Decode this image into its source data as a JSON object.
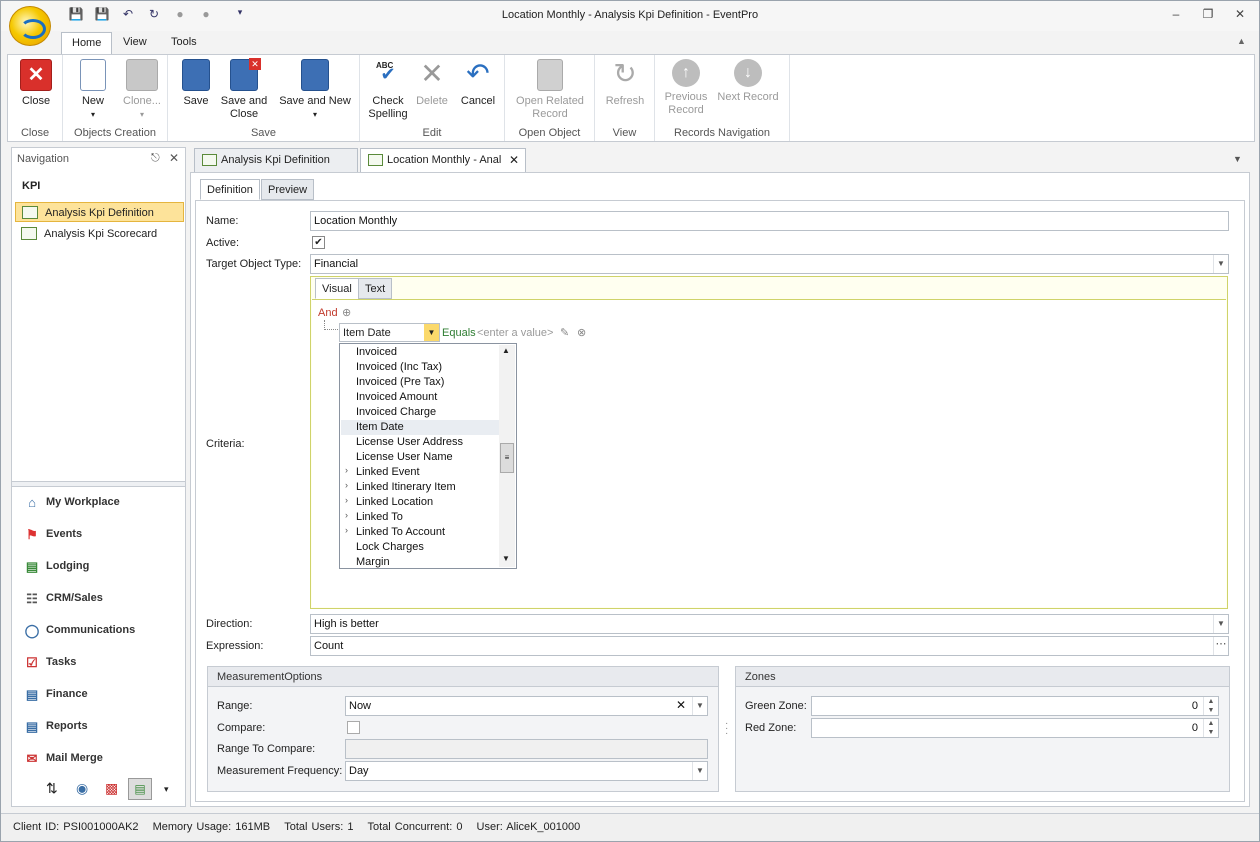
{
  "window": {
    "title": "Location Monthly - Analysis Kpi Definition - EventPro"
  },
  "ribbon_tabs": [
    "Home",
    "View",
    "Tools"
  ],
  "ribbon": {
    "close": {
      "label": "Close",
      "group": "Close"
    },
    "objects": {
      "new": "New",
      "clone": "Clone...",
      "group": "Objects Creation"
    },
    "save": {
      "save": "Save",
      "save_close_1": "Save and",
      "save_close_2": "Close",
      "save_new": "Save and New",
      "group": "Save"
    },
    "edit": {
      "check_1": "Check",
      "check_2": "Spelling",
      "delete": "Delete",
      "cancel": "Cancel",
      "group": "Edit",
      "abc": "ABC"
    },
    "open": {
      "l1": "Open Related",
      "l2": "Record",
      "group": "Open Object"
    },
    "view": {
      "refresh": "Refresh",
      "group": "View"
    },
    "nav": {
      "prev_1": "Previous",
      "prev_2": "Record",
      "next": "Next Record",
      "group": "Records Navigation"
    }
  },
  "navigation": {
    "header": "Navigation",
    "section": "KPI",
    "items": [
      "Analysis Kpi Definition",
      "Analysis Kpi Scorecard"
    ],
    "modules": [
      "My Workplace",
      "Events",
      "Lodging",
      "CRM/Sales",
      "Communications",
      "Tasks",
      "Finance",
      "Reports",
      "Mail Merge"
    ]
  },
  "doc_tabs": [
    "Analysis Kpi Definition",
    "Location Monthly - Anal"
  ],
  "sub_tabs": [
    "Definition",
    "Preview"
  ],
  "form": {
    "name_label": "Name:",
    "name_value": "Location Monthly",
    "active_label": "Active:",
    "target_label": "Target Object Type:",
    "target_value": "Financial",
    "criteria_label": "Criteria:",
    "criteria_tabs": [
      "Visual",
      "Text"
    ],
    "and_label": "And",
    "field_value": "Item Date",
    "operator": "Equals",
    "value_placeholder": "<enter a value>",
    "direction_label": "Direction:",
    "direction_value": "High is better",
    "expression_label": "Expression:",
    "expression_value": "Count"
  },
  "field_list": [
    {
      "label": "Invoiced",
      "expand": false
    },
    {
      "label": "Invoiced (Inc Tax)",
      "expand": false
    },
    {
      "label": "Invoiced (Pre Tax)",
      "expand": false
    },
    {
      "label": "Invoiced Amount",
      "expand": false
    },
    {
      "label": "Invoiced Charge",
      "expand": false
    },
    {
      "label": "Item Date",
      "expand": false,
      "highlight": true
    },
    {
      "label": "License User Address",
      "expand": false
    },
    {
      "label": "License User Name",
      "expand": false
    },
    {
      "label": "Linked Event",
      "expand": true
    },
    {
      "label": "Linked Itinerary Item",
      "expand": true
    },
    {
      "label": "Linked Location",
      "expand": true
    },
    {
      "label": "Linked To",
      "expand": true
    },
    {
      "label": "Linked To Account",
      "expand": true
    },
    {
      "label": "Lock Charges",
      "expand": false
    },
    {
      "label": "Margin",
      "expand": false
    }
  ],
  "measurement": {
    "header": "MeasurementOptions",
    "range_label": "Range:",
    "range_value": "Now",
    "compare_label": "Compare:",
    "range_compare_label": "Range To Compare:",
    "freq_label": "Measurement Frequency:",
    "freq_value": "Day"
  },
  "zones": {
    "header": "Zones",
    "green_label": "Green Zone:",
    "green_value": "0",
    "red_label": "Red Zone:",
    "red_value": "0"
  },
  "status": {
    "client": "Client ID: PSI001000AK2",
    "memory": "Memory Usage: 161MB",
    "users": "Total Users: 1",
    "concurrent": "Total Concurrent: 0",
    "user": "User: AliceK_001000"
  }
}
